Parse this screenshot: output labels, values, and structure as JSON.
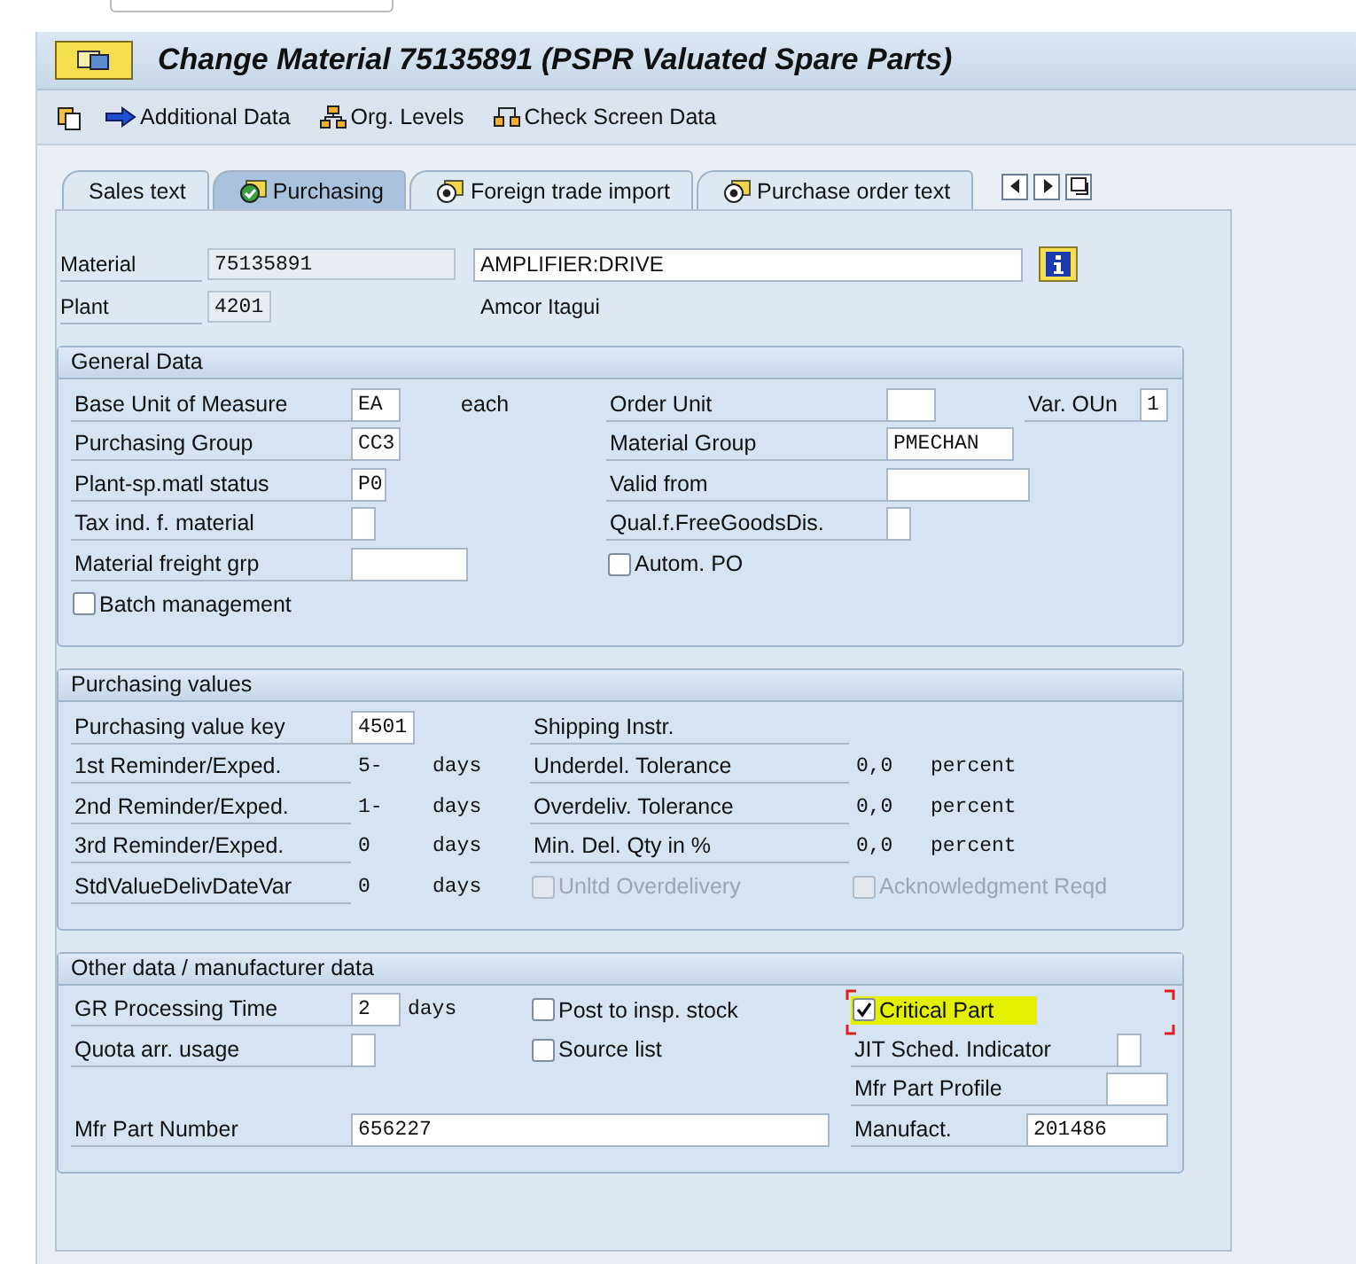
{
  "title": "Change Material 75135891 (PSPR Valuated Spare Parts)",
  "toolbar": [
    "Additional Data",
    "Org. Levels",
    "Check Screen Data"
  ],
  "tabs": [
    {
      "label": "Sales text",
      "selected": false
    },
    {
      "label": "Purchasing",
      "selected": true
    },
    {
      "label": "Foreign trade import",
      "selected": false
    },
    {
      "label": "Purchase order text",
      "selected": false
    }
  ],
  "header": {
    "material": {
      "label": "Material",
      "number": "75135891",
      "description": "AMPLIFIER:DRIVE"
    },
    "plant": {
      "label": "Plant",
      "number": "4201",
      "name": "Amcor Itagui"
    }
  },
  "groups": [
    {
      "title": "General Data",
      "rows": [
        {
          "left": {
            "kind": "field",
            "label": "Base Unit of Measure",
            "value": "EA",
            "unit": "each"
          },
          "middle": {
            "kind": "field",
            "label": "Order Unit"
          },
          "right": {
            "kind": "field",
            "label": "Var. OUn",
            "value": "1"
          }
        },
        {
          "left": {
            "kind": "field",
            "label": "Purchasing Group",
            "value": "CC3"
          },
          "middle": {
            "kind": "field",
            "label": "Material Group",
            "value": "PMECHAN"
          }
        },
        {
          "left": {
            "kind": "field",
            "label": "Plant-sp.matl status",
            "value": "P0"
          },
          "middle": {
            "kind": "field",
            "label": "Valid from"
          }
        },
        {
          "left": {
            "kind": "field",
            "label": "Tax ind. f. material"
          },
          "middle": {
            "kind": "field",
            "label": "Qual.f.FreeGoodsDis."
          }
        },
        {
          "left": {
            "kind": "field",
            "label": "Material freight grp"
          },
          "middle": {
            "kind": "checkbox",
            "label": "Autom. PO",
            "checked": false,
            "disabled": false
          }
        },
        {
          "left": {
            "kind": "checkbox",
            "label": "Batch management",
            "checked": false,
            "disabled": false
          }
        }
      ]
    },
    {
      "title": "Purchasing values",
      "rows": [
        {
          "left": {
            "kind": "field",
            "label": "Purchasing value key",
            "value": "4501"
          },
          "middle": {
            "kind": "label",
            "label": "Shipping Instr."
          }
        },
        {
          "left": {
            "kind": "value",
            "label": "1st Reminder/Exped.",
            "value": "5-",
            "unit": "days"
          },
          "middle": {
            "kind": "value",
            "label": "Underdel. Tolerance",
            "value": "0,0",
            "unit": "percent"
          }
        },
        {
          "left": {
            "kind": "value",
            "label": "2nd Reminder/Exped.",
            "value": "1-",
            "unit": "days"
          },
          "middle": {
            "kind": "value",
            "label": "Overdeliv. Tolerance",
            "value": "0,0",
            "unit": "percent"
          }
        },
        {
          "left": {
            "kind": "value",
            "label": "3rd Reminder/Exped.",
            "value": "0",
            "unit": "days"
          },
          "middle": {
            "kind": "value",
            "label": "Min. Del. Qty in %",
            "value": "0,0",
            "unit": "percent"
          }
        },
        {
          "left": {
            "kind": "value",
            "label": "StdValueDelivDateVar",
            "value": "0",
            "unit": "days"
          },
          "middle": {
            "kind": "checkbox",
            "label": "Unltd Overdelivery",
            "checked": false,
            "disabled": true
          },
          "right": {
            "kind": "checkbox",
            "label": "Acknowledgment Reqd",
            "checked": false,
            "disabled": true
          }
        }
      ]
    },
    {
      "title": "Other data / manufacturer data",
      "rows": [
        {
          "left": {
            "kind": "field",
            "label": "GR Processing Time",
            "value": "2",
            "unit": "days"
          },
          "middle": {
            "kind": "checkbox",
            "label": "Post to insp. stock",
            "checked": false,
            "disabled": false
          },
          "right": {
            "kind": "checkbox",
            "label": "Critical Part",
            "checked": true,
            "disabled": false,
            "highlighted": true,
            "focused": true
          }
        },
        {
          "left": {
            "kind": "field",
            "label": "Quota arr. usage"
          },
          "middle": {
            "kind": "checkbox",
            "label": "Source list",
            "checked": false,
            "disabled": false
          },
          "right": {
            "kind": "field",
            "label": "JIT Sched. Indicator"
          }
        },
        {
          "right": {
            "kind": "field",
            "label": "Mfr Part Profile"
          }
        },
        {
          "left": {
            "kind": "field",
            "label": "Mfr Part Number",
            "value": "656227"
          },
          "right": {
            "kind": "field",
            "label": "Manufact.",
            "value": "201486"
          }
        }
      ]
    }
  ]
}
